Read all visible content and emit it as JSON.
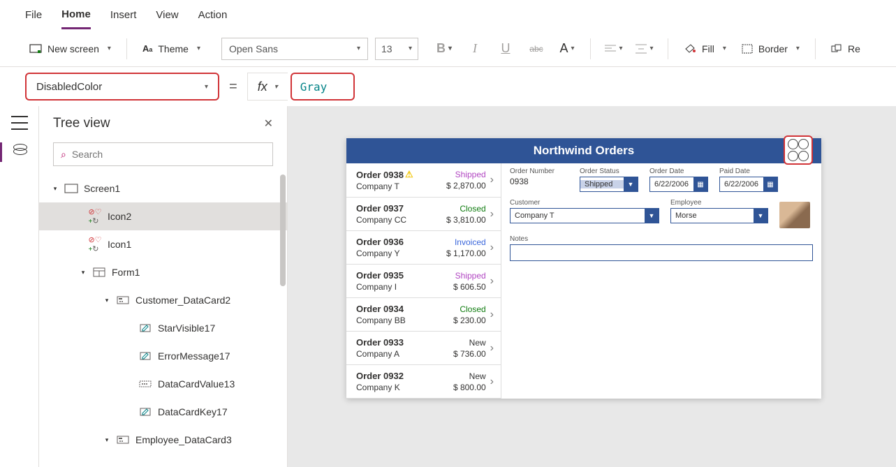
{
  "menubar": {
    "items": [
      "File",
      "Home",
      "Insert",
      "View",
      "Action"
    ],
    "active": "Home"
  },
  "ribbon": {
    "new_screen": "New screen",
    "theme": "Theme",
    "font": "Open Sans",
    "size": "13",
    "fill": "Fill",
    "border": "Border",
    "re": "Re"
  },
  "propbar": {
    "property": "DisabledColor",
    "value": "Gray",
    "fx": "fx"
  },
  "panel": {
    "title": "Tree view",
    "search_placeholder": "Search",
    "tree": [
      {
        "level": 1,
        "caret": "▾",
        "icon": "screen",
        "label": "Screen1"
      },
      {
        "level": 2,
        "caret": "",
        "icon": "icon",
        "label": "Icon2",
        "selected": true
      },
      {
        "level": 2,
        "caret": "",
        "icon": "icon",
        "label": "Icon1"
      },
      {
        "level": 3,
        "caret": "▾",
        "icon": "form",
        "label": "Form1"
      },
      {
        "level": 4,
        "caret": "▾",
        "icon": "card",
        "label": "Customer_DataCard2"
      },
      {
        "level": 5,
        "caret": "",
        "icon": "pencil",
        "label": "StarVisible17"
      },
      {
        "level": 5,
        "caret": "",
        "icon": "pencil",
        "label": "ErrorMessage17"
      },
      {
        "level": 5,
        "caret": "",
        "icon": "input",
        "label": "DataCardValue13"
      },
      {
        "level": 5,
        "caret": "",
        "icon": "pencil",
        "label": "DataCardKey17"
      },
      {
        "level": 4,
        "caret": "▾",
        "icon": "card",
        "label": "Employee_DataCard3"
      }
    ]
  },
  "app": {
    "title": "Northwind Orders",
    "orders": [
      {
        "id": "Order 0938",
        "warn": true,
        "company": "Company T",
        "status": "Shipped",
        "status_cls": "s-shipped",
        "amount": "$ 2,870.00"
      },
      {
        "id": "Order 0937",
        "company": "Company CC",
        "status": "Closed",
        "status_cls": "s-closed",
        "amount": "$ 3,810.00"
      },
      {
        "id": "Order 0936",
        "company": "Company Y",
        "status": "Invoiced",
        "status_cls": "s-invoiced",
        "amount": "$ 1,170.00"
      },
      {
        "id": "Order 0935",
        "company": "Company I",
        "status": "Shipped",
        "status_cls": "s-shipped",
        "amount": "$ 606.50"
      },
      {
        "id": "Order 0934",
        "company": "Company BB",
        "status": "Closed",
        "status_cls": "s-closed",
        "amount": "$ 230.00"
      },
      {
        "id": "Order 0933",
        "company": "Company A",
        "status": "New",
        "status_cls": "s-new",
        "amount": "$ 736.00"
      },
      {
        "id": "Order 0932",
        "company": "Company K",
        "status": "New",
        "status_cls": "s-new",
        "amount": "$ 800.00"
      }
    ],
    "detail": {
      "order_number_label": "Order Number",
      "order_number": "0938",
      "order_status_label": "Order Status",
      "order_status": "Shipped",
      "order_date_label": "Order Date",
      "order_date": "6/22/2006",
      "paid_date_label": "Paid Date",
      "paid_date": "6/22/2006",
      "customer_label": "Customer",
      "customer": "Company T",
      "employee_label": "Employee",
      "employee": "Morse",
      "notes_label": "Notes"
    }
  }
}
